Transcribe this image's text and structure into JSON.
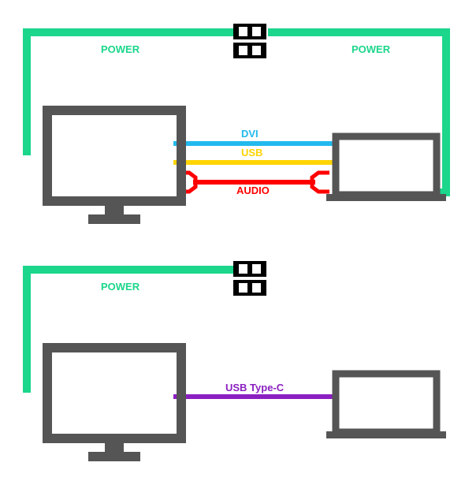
{
  "labels": {
    "top": {
      "power_left": "POWER",
      "power_right": "POWER",
      "dvi": "DVI",
      "usb": "USB",
      "audio": "AUDIO"
    },
    "bottom": {
      "power_left": "POWER",
      "usb_c": "USB Type-C"
    }
  },
  "colors": {
    "power": "#1bd68b",
    "dvi": "#22b9ee",
    "usb": "#ffd400",
    "audio": "#ff0000",
    "usb_c": "#8b1fc0",
    "device": "#555555",
    "outlet": "#000000"
  },
  "chart_data": {
    "type": "diagram",
    "title": "Cable connection comparison: multi-cable vs USB Type-C",
    "scenarios": [
      {
        "name": "multi_cable",
        "devices": [
          "monitor",
          "laptop",
          "wall_outlet"
        ],
        "connections": [
          {
            "from": "monitor",
            "to": "wall_outlet",
            "type": "POWER",
            "color": "#1bd68b"
          },
          {
            "from": "laptop",
            "to": "wall_outlet",
            "type": "POWER",
            "color": "#1bd68b"
          },
          {
            "from": "monitor",
            "to": "laptop",
            "type": "DVI",
            "color": "#22b9ee"
          },
          {
            "from": "monitor",
            "to": "laptop",
            "type": "USB",
            "color": "#ffd400"
          },
          {
            "from": "monitor",
            "to": "laptop",
            "type": "AUDIO",
            "color": "#ff0000"
          }
        ]
      },
      {
        "name": "usb_type_c",
        "devices": [
          "monitor",
          "laptop",
          "wall_outlet"
        ],
        "connections": [
          {
            "from": "monitor",
            "to": "wall_outlet",
            "type": "POWER",
            "color": "#1bd68b"
          },
          {
            "from": "monitor",
            "to": "laptop",
            "type": "USB Type-C",
            "color": "#8b1fc0"
          }
        ]
      }
    ]
  }
}
